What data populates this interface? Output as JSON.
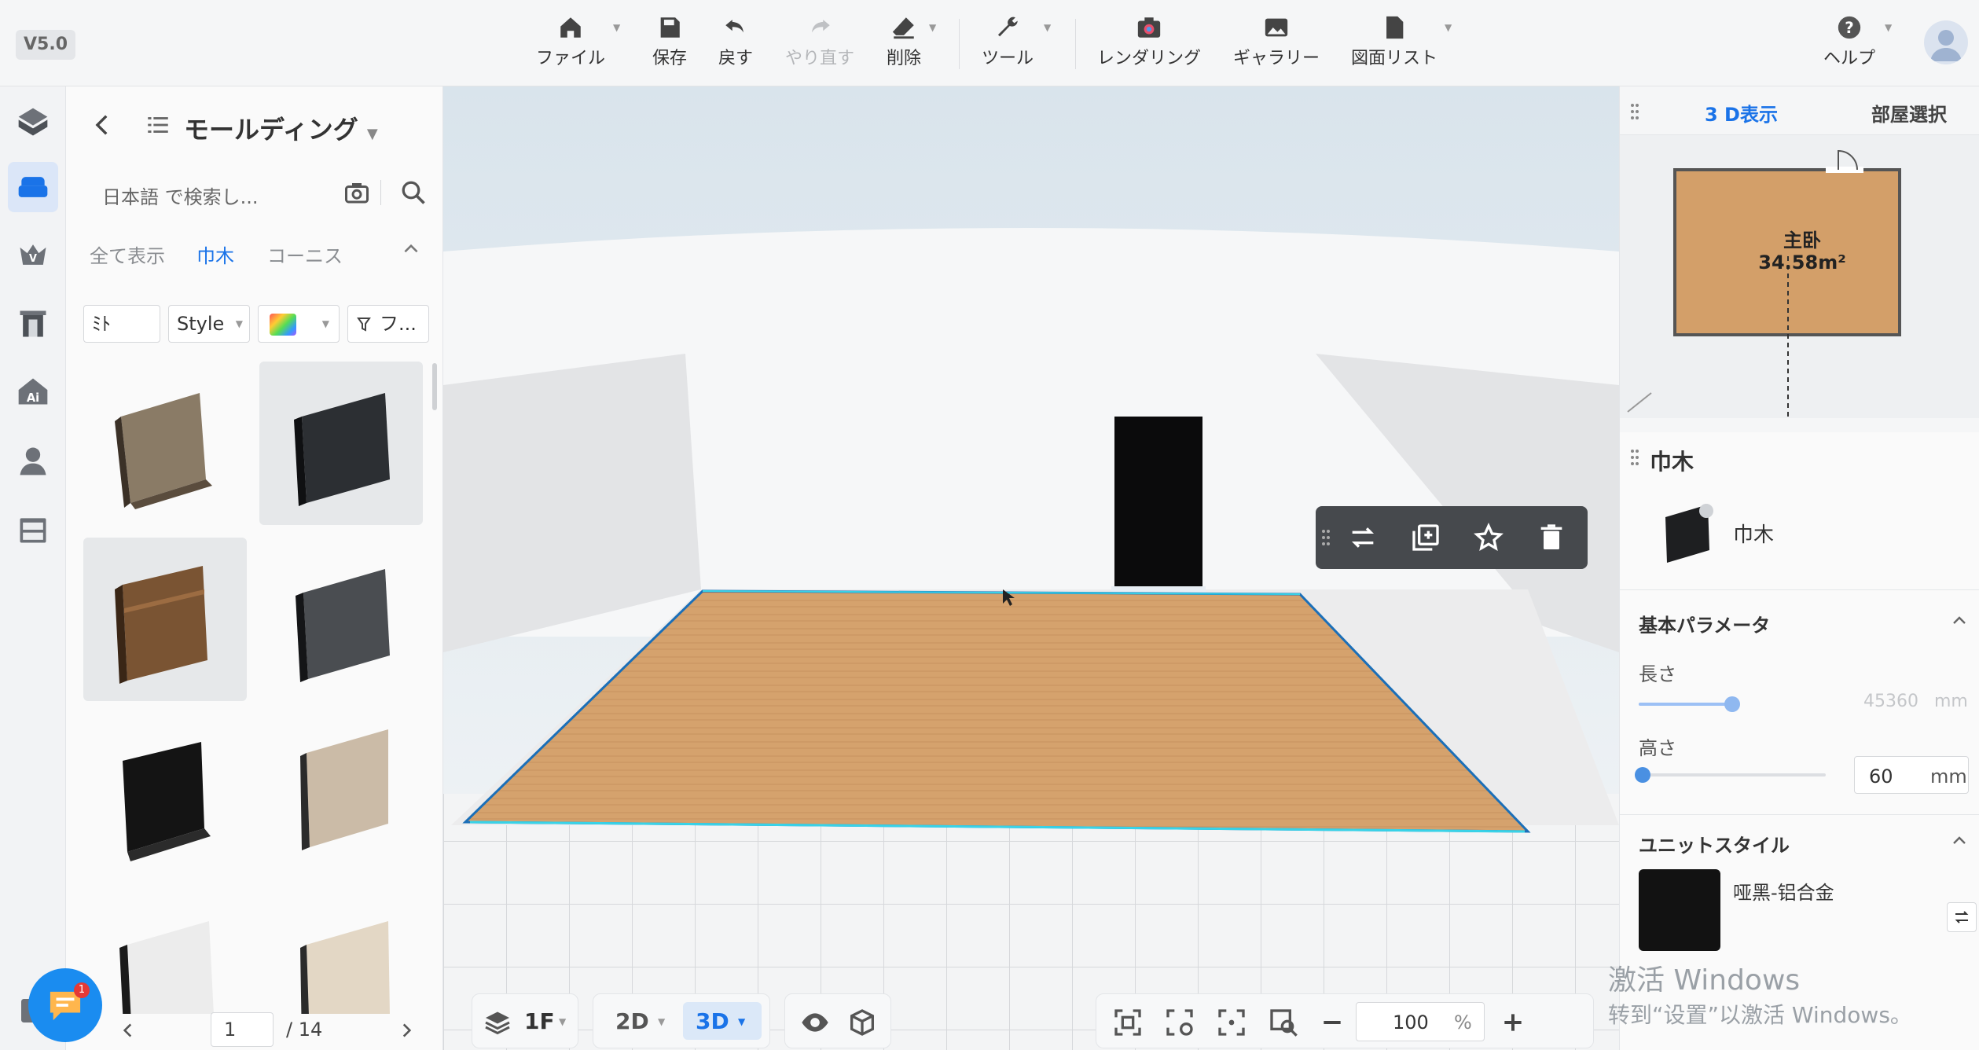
{
  "app": {
    "version": "V5.0"
  },
  "toolbar": {
    "file": "ファイル",
    "save": "保存",
    "undo": "戻す",
    "redo": "やり直す",
    "delete": "削除",
    "tools": "ツール",
    "render": "レンダリング",
    "gallery": "ギャラリー",
    "drawings": "図面リスト",
    "help": "ヘルプ"
  },
  "left_panel": {
    "title": "モールディング",
    "search_placeholder": "日本語 で検索し...",
    "tabs": [
      "全て表示",
      "巾木",
      "コーニス"
    ],
    "active_tab": "巾木",
    "filters": {
      "sort": "ﾐﾄ",
      "style": "Style",
      "filter": "フ..."
    },
    "pager": {
      "current": "1",
      "total": "/ 14"
    }
  },
  "right_panel": {
    "tabs": [
      "3 D表示",
      "部屋選択"
    ],
    "active_tab": "3 D表示",
    "room": {
      "name": "主卧",
      "area": "34.58m²"
    },
    "selection_title": "巾木",
    "item_name": "巾木",
    "basic_params_title": "基本パラメータ",
    "length_label": "長さ",
    "length_value": "45360",
    "length_unit": "mm",
    "length_level": 0.99,
    "height_label": "高さ",
    "height_value": "60",
    "height_unit": "mm",
    "height_level": 0.02,
    "unit_style_title": "ユニットスタイル",
    "material_name": "哑黑-铝合金"
  },
  "bottom_bar": {
    "floor": "1F",
    "view_2d": "2D",
    "view_3d": "3D",
    "zoom_value": "100",
    "zoom_unit": "%"
  },
  "watermark": {
    "line1": "激活 Windows",
    "line2": "转到“设置”以激活 Windows。"
  },
  "chat": {
    "badge": "1"
  },
  "colors": {
    "accent": "#1a73e8",
    "floor": "#d7a470",
    "toolbar_dark": "#46494d"
  }
}
